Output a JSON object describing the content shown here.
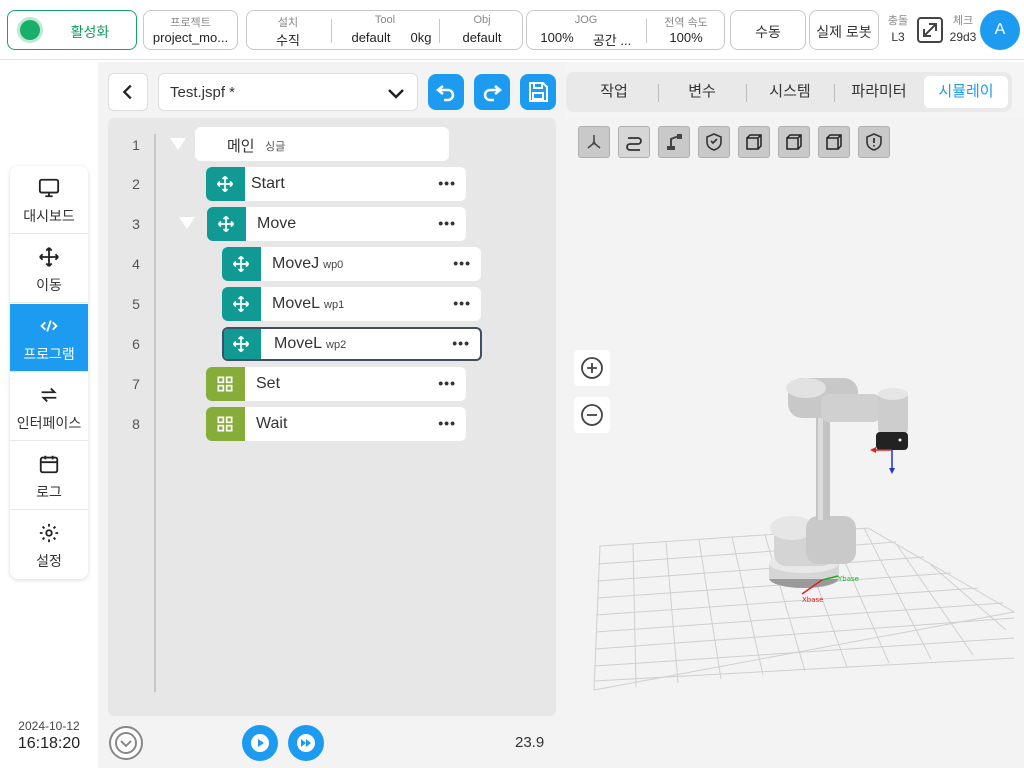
{
  "topbar": {
    "activate_label": "활성화",
    "project": {
      "caption": "프로젝트",
      "value": "project_mo..."
    },
    "install": {
      "caption": "설치",
      "value": "수직"
    },
    "tool": {
      "caption": "Tool",
      "value": "default",
      "weight": "0kg"
    },
    "obj": {
      "caption": "Obj",
      "value": "default"
    },
    "jog": {
      "caption": "JOG",
      "value": "100%",
      "space": "공간 ..."
    },
    "global_speed": {
      "caption": "전역 속도",
      "value": "100%"
    },
    "manual_label": "수동",
    "robot_label": "실제 로봇",
    "collision": {
      "caption": "충돌",
      "value": "L3"
    },
    "check": {
      "caption": "체크",
      "value": "29d3"
    },
    "avatar_letter": "A",
    "accent_color": "#1d9bf0",
    "active_color": "#0f9d5c"
  },
  "nav": {
    "items": [
      {
        "label": "대시보드",
        "icon": "monitor-icon"
      },
      {
        "label": "이동",
        "icon": "move-arrows-icon"
      },
      {
        "label": "프로그램",
        "icon": "code-icon"
      },
      {
        "label": "인터페이스",
        "icon": "swap-arrows-icon"
      },
      {
        "label": "로그",
        "icon": "calendar-icon"
      },
      {
        "label": "설정",
        "icon": "gear-icon"
      }
    ],
    "active": "프로그램"
  },
  "datetime": {
    "date": "2024-10-12",
    "time": "16:18:20"
  },
  "program": {
    "file_name": "Test.jspf *",
    "tree": {
      "main_label": "메인",
      "main_sub": "싱글",
      "line_numbers": [
        "1",
        "2",
        "3",
        "4",
        "5",
        "6",
        "7",
        "8"
      ],
      "nodes": [
        {
          "name": "Start",
          "wp": "",
          "icon": "move-arrows-icon"
        },
        {
          "name": "Move",
          "wp": "",
          "icon": "move-arrows-icon"
        },
        {
          "name": "MoveJ",
          "wp": "wp0",
          "icon": "move-arrows-icon"
        },
        {
          "name": "MoveL",
          "wp": "wp1",
          "icon": "move-arrows-icon"
        },
        {
          "name": "MoveL",
          "wp": "wp2",
          "icon": "move-arrows-icon"
        },
        {
          "name": "Set",
          "wp": "",
          "icon": "grid-icon"
        },
        {
          "name": "Wait",
          "wp": "",
          "icon": "grid-icon"
        }
      ],
      "more_label": "•••",
      "teal_color": "#119a94",
      "olive_color": "#86ac3a"
    },
    "speed": "23.9"
  },
  "right": {
    "tabs": [
      "작업",
      "변수",
      "시스템",
      "파라미터",
      "시뮬레이"
    ],
    "active_tab": "시뮬레이",
    "view_tools": [
      "axes-icon",
      "path-icon",
      "robot-arm-icon",
      "shield-check-icon",
      "cube-front-icon",
      "cube-side-icon",
      "cube-top-icon",
      "shield-alert-icon"
    ],
    "axis_labels": {
      "x": "Xbase",
      "y": "Ybase"
    }
  }
}
